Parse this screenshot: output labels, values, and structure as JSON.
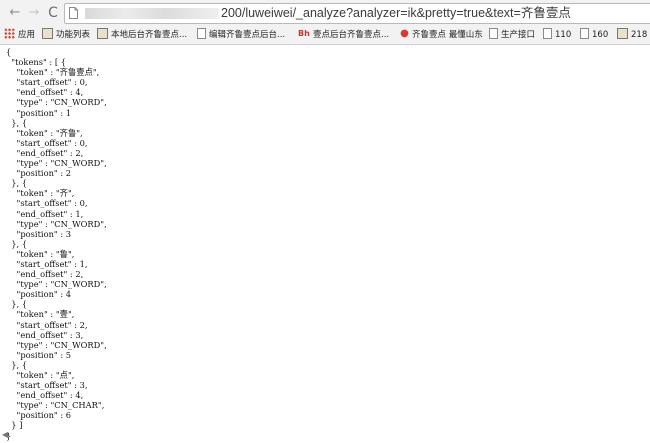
{
  "browser": {
    "back_icon": "back-arrow-icon",
    "forward_icon": "forward-arrow-icon",
    "reload_icon": "reload-icon",
    "back_glyph": "←",
    "forward_glyph": "→",
    "reload_glyph": "C",
    "url_visible": "200/luweiwei/_analyze?analyzer=ik&pretty=true&text=齐鲁壹点"
  },
  "bookmarks": [
    {
      "icon": "apps-icon",
      "label": "应用"
    },
    {
      "icon": "image-icon",
      "label": "功能列表"
    },
    {
      "icon": "image-icon",
      "label": "本地后台齐鲁壹点..."
    },
    {
      "icon": "document-icon",
      "label": "编辑齐鲁壹点后台..."
    },
    {
      "icon": "bsi-icon",
      "icon_text": "Bh",
      "label": "壹点后台齐鲁壹点..."
    },
    {
      "icon": "pin-icon",
      "icon_text": "●",
      "label": "齐鲁壹点 最懂山东"
    },
    {
      "icon": "document-icon",
      "label": "生产接口"
    },
    {
      "icon": "document-icon",
      "label": "110"
    },
    {
      "icon": "document-icon",
      "label": "160"
    },
    {
      "icon": "image-icon",
      "label": "218"
    }
  ],
  "response_json": "{\n  \"tokens\" : [ {\n    \"token\" : \"齐鲁壹点\",\n    \"start_offset\" : 0,\n    \"end_offset\" : 4,\n    \"type\" : \"CN_WORD\",\n    \"position\" : 1\n  }, {\n    \"token\" : \"齐鲁\",\n    \"start_offset\" : 0,\n    \"end_offset\" : 2,\n    \"type\" : \"CN_WORD\",\n    \"position\" : 2\n  }, {\n    \"token\" : \"齐\",\n    \"start_offset\" : 0,\n    \"end_offset\" : 1,\n    \"type\" : \"CN_WORD\",\n    \"position\" : 3\n  }, {\n    \"token\" : \"鲁\",\n    \"start_offset\" : 1,\n    \"end_offset\" : 2,\n    \"type\" : \"CN_WORD\",\n    \"position\" : 4\n  }, {\n    \"token\" : \"壹\",\n    \"start_offset\" : 2,\n    \"end_offset\" : 3,\n    \"type\" : \"CN_WORD\",\n    \"position\" : 5\n  }, {\n    \"token\" : \"点\",\n    \"start_offset\" : 3,\n    \"end_offset\" : 4,\n    \"type\" : \"CN_CHAR\",\n    \"position\" : 6\n  } ]\n}",
  "scroll_left_icon": "scroll-left-arrow-icon",
  "scroll_left_glyph": "◀"
}
